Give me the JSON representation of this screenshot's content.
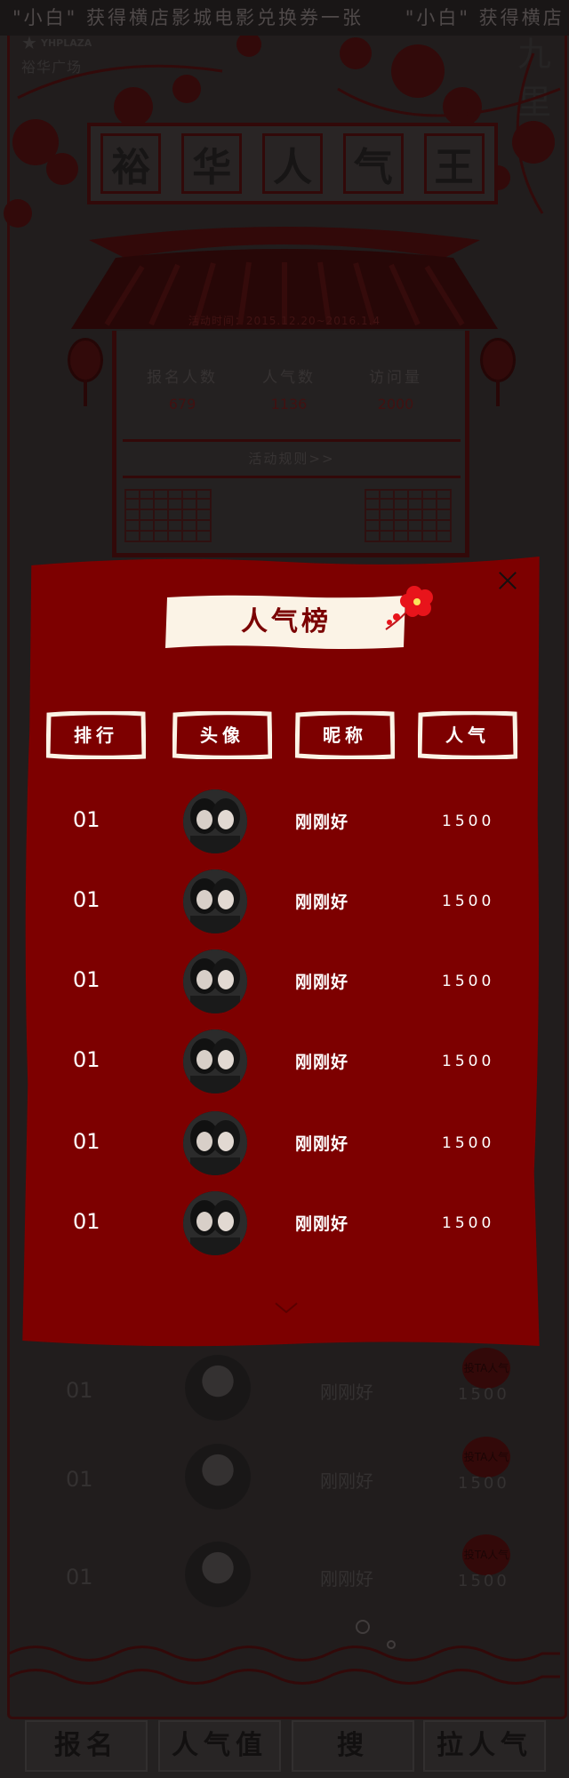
{
  "ticker": {
    "item1": "\"小白\" 获得横店影城电影兑换券一张",
    "item2": "\"小白\" 获得横店"
  },
  "logo": {
    "en": "YHPLAZA",
    "cn": "裕华广场",
    "corner": "九里"
  },
  "title": {
    "chars": [
      "裕",
      "华",
      "人",
      "气",
      "王"
    ]
  },
  "activity_time": "活动时间：2015.12.20~2016.1.4",
  "stats": [
    {
      "label": "报名人数",
      "value": "679"
    },
    {
      "label": "人气数",
      "value": "1136"
    },
    {
      "label": "访问量",
      "value": "2000"
    }
  ],
  "rules_label": "活动规则>>",
  "background_list": {
    "vote_label": "投TA人气",
    "rows": [
      {
        "rank": "01",
        "name": "刚刚好",
        "popularity": "1500"
      },
      {
        "rank": "01",
        "name": "刚刚好",
        "popularity": "1500"
      },
      {
        "rank": "01",
        "name": "刚刚好",
        "popularity": "1500"
      }
    ]
  },
  "bottom_nav": [
    "报名",
    "人气值",
    "搜",
    "拉人气"
  ],
  "modal": {
    "title": "人气榜",
    "headers": [
      "排行",
      "头像",
      "昵称",
      "人气"
    ],
    "rows": [
      {
        "rank": "01",
        "name": "刚刚好",
        "popularity": "1500"
      },
      {
        "rank": "01",
        "name": "刚刚好",
        "popularity": "1500"
      },
      {
        "rank": "01",
        "name": "刚刚好",
        "popularity": "1500"
      },
      {
        "rank": "01",
        "name": "刚刚好",
        "popularity": "1500"
      },
      {
        "rank": "01",
        "name": "刚刚好",
        "popularity": "1500"
      },
      {
        "rank": "01",
        "name": "刚刚好",
        "popularity": "1500"
      }
    ]
  },
  "colors": {
    "modal_red": "#7d0000",
    "cream": "#fbf3e6",
    "flower_red": "#e8141b"
  }
}
